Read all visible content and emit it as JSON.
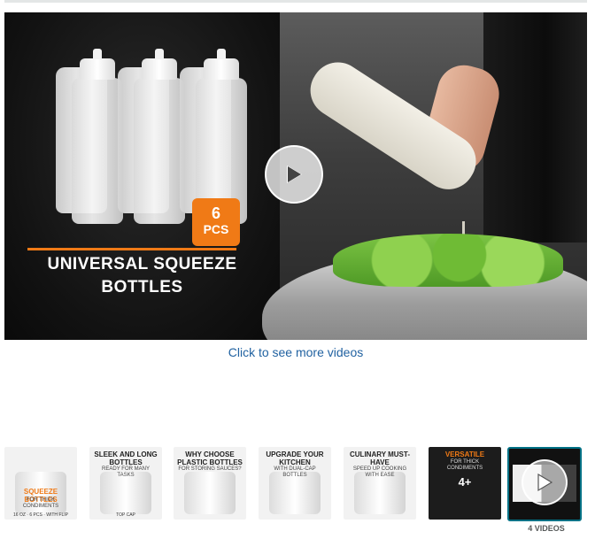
{
  "hero": {
    "left_panel": {
      "badge_number": "6",
      "badge_label": "PCS",
      "title_line1": "UNIVERSAL SQUEEZE",
      "title_line2": "BOTTLES",
      "accent_color": "#f07a16"
    },
    "play_icon": "play-icon"
  },
  "more_videos_link": "Click to see more videos",
  "thumbnails": [
    {
      "title": "Squeeze Bottles",
      "subtitle": "For Thick Condiments",
      "footer": "16 oz · 6 Pcs · With Flip",
      "style": "light"
    },
    {
      "title": "Sleek and Long Bottles",
      "subtitle": "Ready for Many Tasks",
      "footer": "Top Cap",
      "style": "light"
    },
    {
      "title": "Why Choose Plastic Bottles",
      "subtitle": "For Storing Sauces?",
      "footer": "",
      "style": "light"
    },
    {
      "title": "Upgrade Your Kitchen",
      "subtitle": "With Dual-Cap Bottles",
      "footer": "",
      "style": "light"
    },
    {
      "title": "Culinary Must-Have",
      "subtitle": "Speed Up Cooking With Ease",
      "footer": "",
      "style": "light"
    },
    {
      "title": "Versatile",
      "subtitle": "For Thick Condiments",
      "footer": "",
      "style": "dark",
      "more_count": "4+"
    }
  ],
  "video_thumbnail": {
    "play_icon": "play-icon",
    "count_label": "4 VIDEOS",
    "border_color": "#007185"
  },
  "colors": {
    "link": "#2162a1",
    "accent": "#f07a16"
  }
}
